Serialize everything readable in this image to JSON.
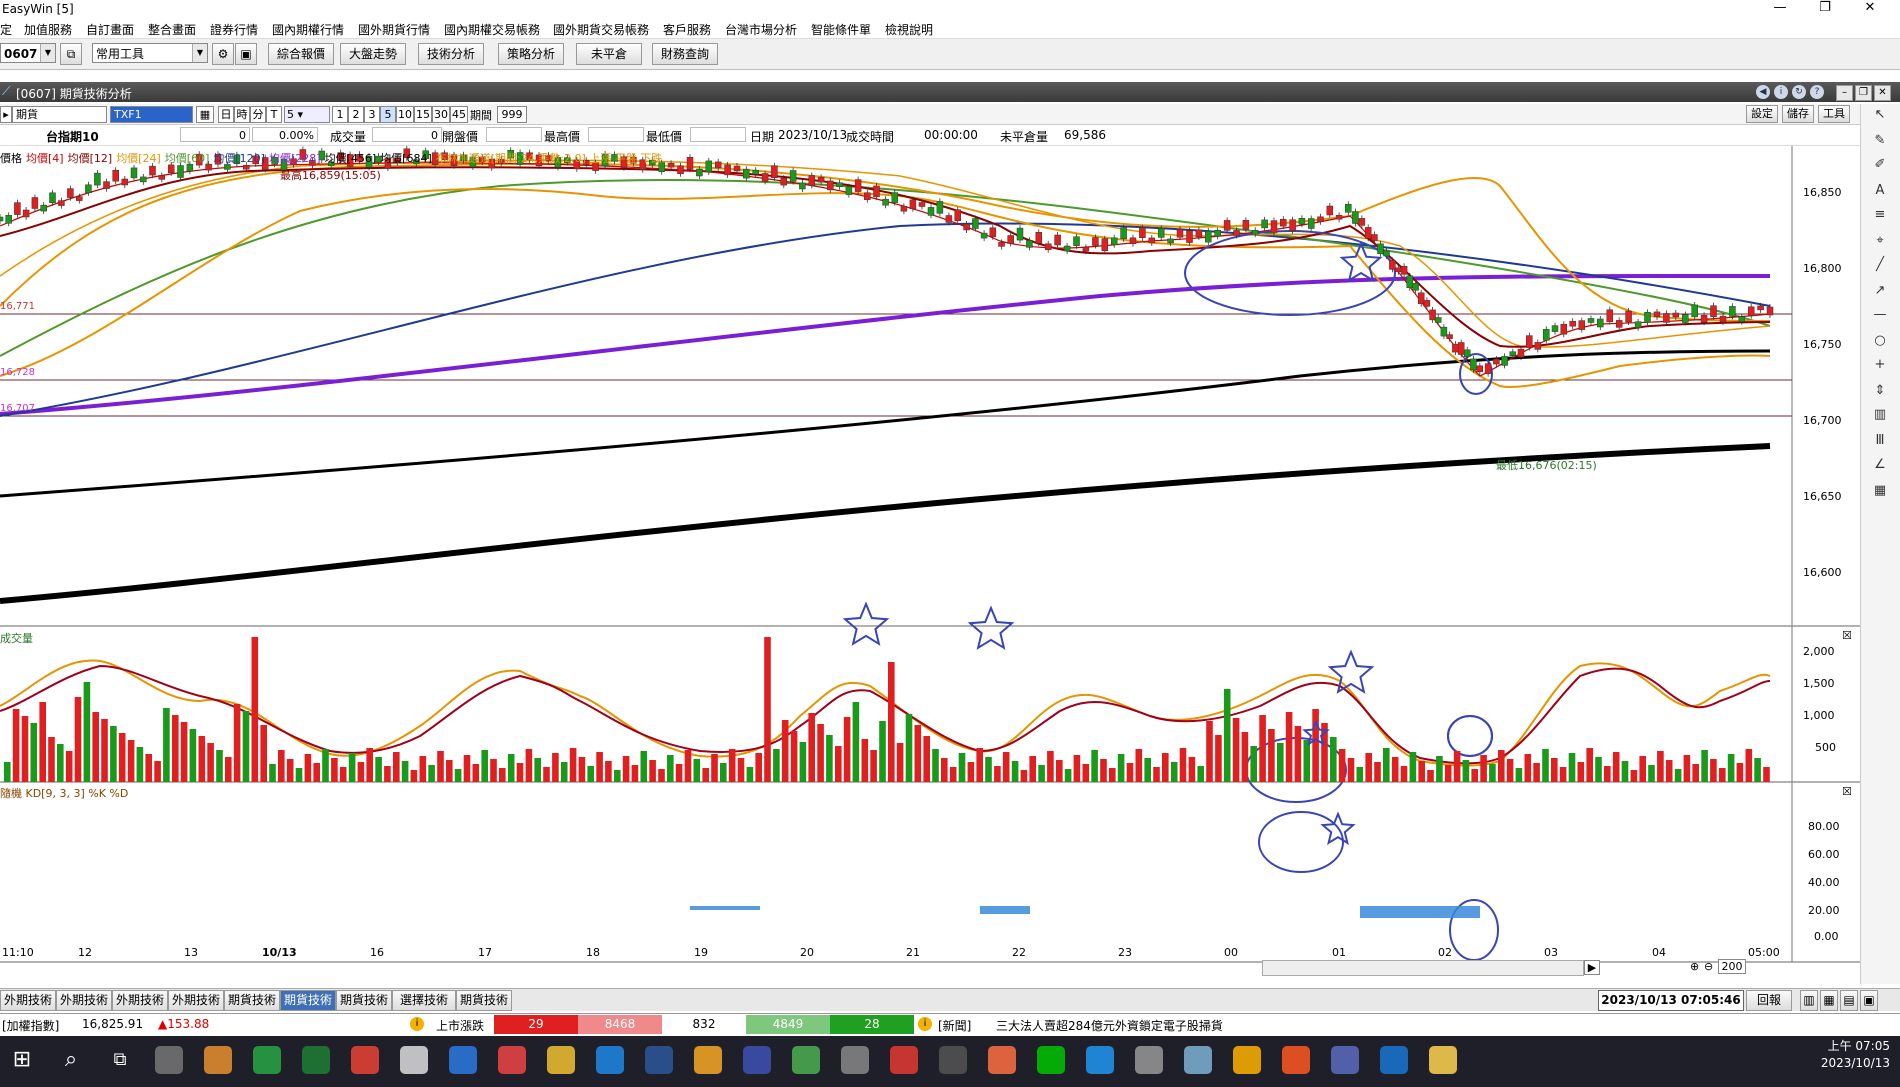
{
  "window": {
    "title": "EasyWin  [5]",
    "controls": [
      "—",
      "❐",
      "✕"
    ]
  },
  "menu": [
    "定",
    "加值服務",
    "自訂畫面",
    "整合畫面",
    "證券行情",
    "國內期權行情",
    "國外期貨行情",
    "國內期權交易帳務",
    "國外期貨交易帳務",
    "客戶服務",
    "台灣市場分析",
    "智能條件單",
    "檢視說明"
  ],
  "toolbar": {
    "code_value": "0607",
    "tool_select": "常用工具",
    "buttons": [
      "綜合報價",
      "大盤走勢",
      "技術分析",
      "策略分析",
      "未平倉",
      "財務查詢"
    ]
  },
  "subwindow": {
    "title": "[0607] 期貨技術分析",
    "right_buttons": [
      "設定",
      "儲存",
      "工具"
    ]
  },
  "chart_toolbar": {
    "type_select": "期貨",
    "symbol_input": "TXF1",
    "period_keys": [
      "日",
      "時",
      "分",
      "T",
      "5"
    ],
    "minute_keys": [
      "1",
      "2",
      "3",
      "5",
      "10",
      "15",
      "30",
      "45"
    ],
    "period_label": "期間",
    "period_value": "999"
  },
  "info": {
    "name": "台指期10",
    "price": "0",
    "change_pct": "0.00%",
    "volume_label": "成交量",
    "volume": "0",
    "open_label": "開盤價",
    "high_label": "最高價",
    "low_label": "最低價",
    "date_label": "日期",
    "date": "2023/10/13",
    "time_label": "成交時間",
    "time": "00:00:00",
    "oi_label": "未平倉量",
    "oi": "69,586"
  },
  "legend": {
    "items": [
      {
        "text": "價格",
        "color": "#000000"
      },
      {
        "text": "均價[4]",
        "color": "#cc0000"
      },
      {
        "text": "均價[12]",
        "color": "#8b0000"
      },
      {
        "text": "均價[24]",
        "color": "#e69500"
      },
      {
        "text": "均價[60]",
        "color": "#4c9a2a"
      },
      {
        "text": "均價[120]",
        "color": "#1f3a93"
      },
      {
        "text": "均價[228]",
        "color": "#8a2be2"
      },
      {
        "text": "均價[456]",
        "color": "#000000"
      },
      {
        "text": "均價[684]",
        "color": "#000000"
      },
      {
        "text": "布林加通道[期間:24,乘數:2.0] 上漲  平盤  下跌",
        "color": "#e69500"
      }
    ],
    "high_note": "最高16,859(15:05)",
    "low_note": "最低16,676(02:15)",
    "left_marks": [
      "16,771",
      "16,728",
      "16,707"
    ]
  },
  "price_axis": [
    "16,850",
    "16,800",
    "16,750",
    "16,700",
    "16,650",
    "16,600"
  ],
  "volume_panel": {
    "title": "成交量",
    "axis": [
      "2,000",
      "1,500",
      "1,000",
      "500"
    ]
  },
  "kd_panel": {
    "title": "隨機 KD[9, 3, 3] %K  %D",
    "axis": [
      "80.00",
      "60.00",
      "40.00",
      "20.00",
      "0.00"
    ]
  },
  "x_axis": [
    "11:10",
    "12",
    "13",
    "10/13",
    "16",
    "17",
    "18",
    "19",
    "20",
    "21",
    "22",
    "23",
    "00",
    "01",
    "02",
    "03",
    "04",
    "05:00"
  ],
  "zoom": "200",
  "tabs": [
    "外期技術",
    "外期技術",
    "外期技術",
    "外期技術",
    "期貨技術",
    "期貨技術",
    "期貨技術",
    "選擇技術",
    "期貨技術"
  ],
  "active_tab": 5,
  "datetime_box": "2023/10/13 07:05:46",
  "return_btn": "回報",
  "status": {
    "index_label": "[加權指數]",
    "index_value": "16,825.91",
    "index_change": "▲153.88",
    "market_label": "上市漲跌",
    "up_limit": "29",
    "up": "8468",
    "flat": "832",
    "down": "4849",
    "down_limit": "28",
    "news_label": "[新聞]",
    "news_text": "三大法人賣超284億元外資鎖定電子股掃貨"
  },
  "taskbar": {
    "time": "上午 07:05",
    "date": "2023/10/13"
  }
}
